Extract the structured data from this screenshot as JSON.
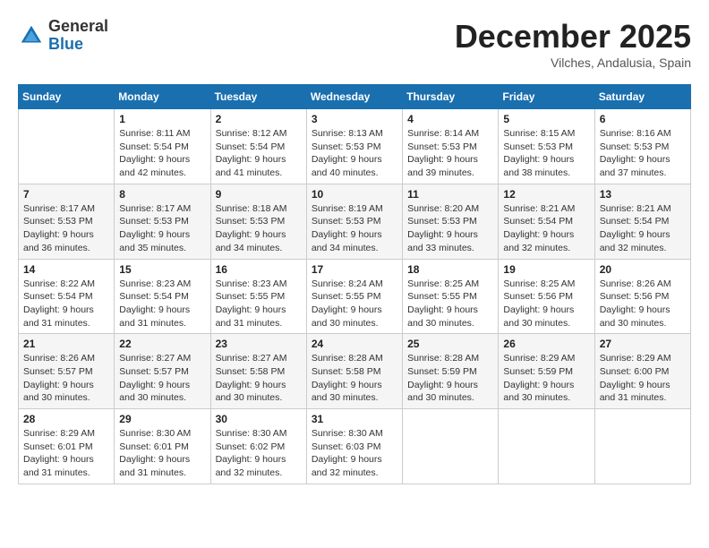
{
  "logo": {
    "general": "General",
    "blue": "Blue"
  },
  "title": "December 2025",
  "location": "Vilches, Andalusia, Spain",
  "weekdays": [
    "Sunday",
    "Monday",
    "Tuesday",
    "Wednesday",
    "Thursday",
    "Friday",
    "Saturday"
  ],
  "weeks": [
    [
      {
        "day": "",
        "info": ""
      },
      {
        "day": "1",
        "info": "Sunrise: 8:11 AM\nSunset: 5:54 PM\nDaylight: 9 hours\nand 42 minutes."
      },
      {
        "day": "2",
        "info": "Sunrise: 8:12 AM\nSunset: 5:54 PM\nDaylight: 9 hours\nand 41 minutes."
      },
      {
        "day": "3",
        "info": "Sunrise: 8:13 AM\nSunset: 5:53 PM\nDaylight: 9 hours\nand 40 minutes."
      },
      {
        "day": "4",
        "info": "Sunrise: 8:14 AM\nSunset: 5:53 PM\nDaylight: 9 hours\nand 39 minutes."
      },
      {
        "day": "5",
        "info": "Sunrise: 8:15 AM\nSunset: 5:53 PM\nDaylight: 9 hours\nand 38 minutes."
      },
      {
        "day": "6",
        "info": "Sunrise: 8:16 AM\nSunset: 5:53 PM\nDaylight: 9 hours\nand 37 minutes."
      }
    ],
    [
      {
        "day": "7",
        "info": "Sunrise: 8:17 AM\nSunset: 5:53 PM\nDaylight: 9 hours\nand 36 minutes."
      },
      {
        "day": "8",
        "info": "Sunrise: 8:17 AM\nSunset: 5:53 PM\nDaylight: 9 hours\nand 35 minutes."
      },
      {
        "day": "9",
        "info": "Sunrise: 8:18 AM\nSunset: 5:53 PM\nDaylight: 9 hours\nand 34 minutes."
      },
      {
        "day": "10",
        "info": "Sunrise: 8:19 AM\nSunset: 5:53 PM\nDaylight: 9 hours\nand 34 minutes."
      },
      {
        "day": "11",
        "info": "Sunrise: 8:20 AM\nSunset: 5:53 PM\nDaylight: 9 hours\nand 33 minutes."
      },
      {
        "day": "12",
        "info": "Sunrise: 8:21 AM\nSunset: 5:54 PM\nDaylight: 9 hours\nand 32 minutes."
      },
      {
        "day": "13",
        "info": "Sunrise: 8:21 AM\nSunset: 5:54 PM\nDaylight: 9 hours\nand 32 minutes."
      }
    ],
    [
      {
        "day": "14",
        "info": "Sunrise: 8:22 AM\nSunset: 5:54 PM\nDaylight: 9 hours\nand 31 minutes."
      },
      {
        "day": "15",
        "info": "Sunrise: 8:23 AM\nSunset: 5:54 PM\nDaylight: 9 hours\nand 31 minutes."
      },
      {
        "day": "16",
        "info": "Sunrise: 8:23 AM\nSunset: 5:55 PM\nDaylight: 9 hours\nand 31 minutes."
      },
      {
        "day": "17",
        "info": "Sunrise: 8:24 AM\nSunset: 5:55 PM\nDaylight: 9 hours\nand 30 minutes."
      },
      {
        "day": "18",
        "info": "Sunrise: 8:25 AM\nSunset: 5:55 PM\nDaylight: 9 hours\nand 30 minutes."
      },
      {
        "day": "19",
        "info": "Sunrise: 8:25 AM\nSunset: 5:56 PM\nDaylight: 9 hours\nand 30 minutes."
      },
      {
        "day": "20",
        "info": "Sunrise: 8:26 AM\nSunset: 5:56 PM\nDaylight: 9 hours\nand 30 minutes."
      }
    ],
    [
      {
        "day": "21",
        "info": "Sunrise: 8:26 AM\nSunset: 5:57 PM\nDaylight: 9 hours\nand 30 minutes."
      },
      {
        "day": "22",
        "info": "Sunrise: 8:27 AM\nSunset: 5:57 PM\nDaylight: 9 hours\nand 30 minutes."
      },
      {
        "day": "23",
        "info": "Sunrise: 8:27 AM\nSunset: 5:58 PM\nDaylight: 9 hours\nand 30 minutes."
      },
      {
        "day": "24",
        "info": "Sunrise: 8:28 AM\nSunset: 5:58 PM\nDaylight: 9 hours\nand 30 minutes."
      },
      {
        "day": "25",
        "info": "Sunrise: 8:28 AM\nSunset: 5:59 PM\nDaylight: 9 hours\nand 30 minutes."
      },
      {
        "day": "26",
        "info": "Sunrise: 8:29 AM\nSunset: 5:59 PM\nDaylight: 9 hours\nand 30 minutes."
      },
      {
        "day": "27",
        "info": "Sunrise: 8:29 AM\nSunset: 6:00 PM\nDaylight: 9 hours\nand 31 minutes."
      }
    ],
    [
      {
        "day": "28",
        "info": "Sunrise: 8:29 AM\nSunset: 6:01 PM\nDaylight: 9 hours\nand 31 minutes."
      },
      {
        "day": "29",
        "info": "Sunrise: 8:30 AM\nSunset: 6:01 PM\nDaylight: 9 hours\nand 31 minutes."
      },
      {
        "day": "30",
        "info": "Sunrise: 8:30 AM\nSunset: 6:02 PM\nDaylight: 9 hours\nand 32 minutes."
      },
      {
        "day": "31",
        "info": "Sunrise: 8:30 AM\nSunset: 6:03 PM\nDaylight: 9 hours\nand 32 minutes."
      },
      {
        "day": "",
        "info": ""
      },
      {
        "day": "",
        "info": ""
      },
      {
        "day": "",
        "info": ""
      }
    ]
  ]
}
